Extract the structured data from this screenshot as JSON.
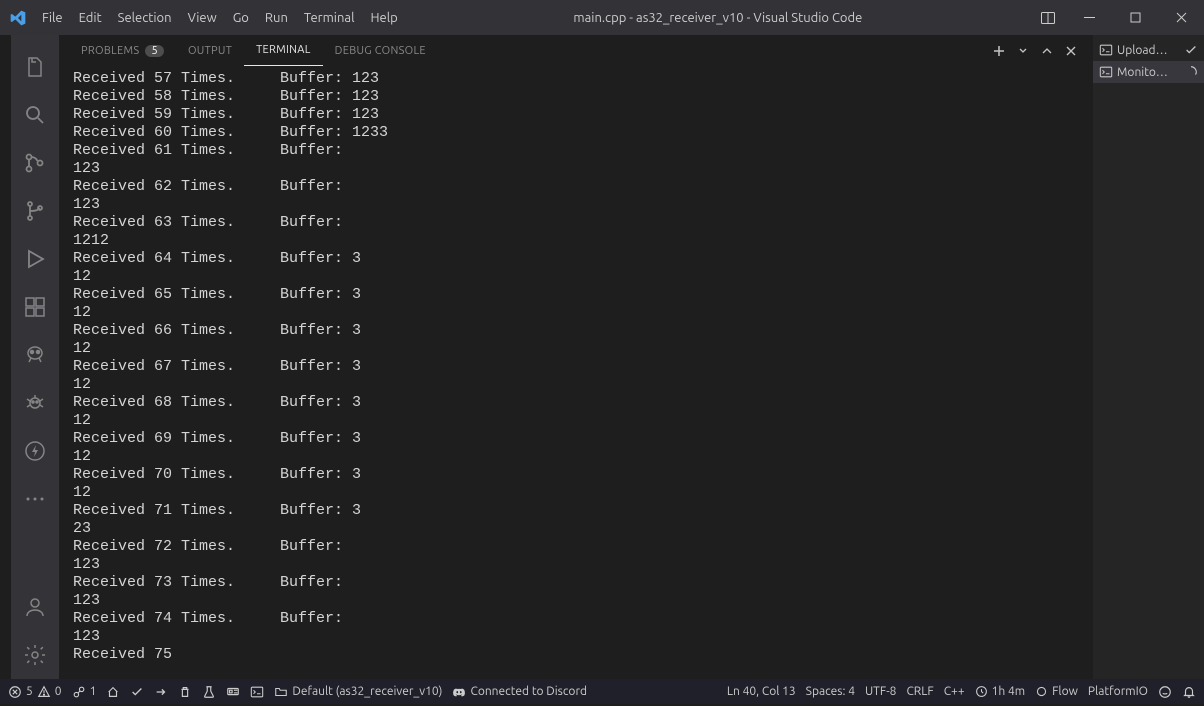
{
  "titlebar": {
    "menu": [
      "File",
      "Edit",
      "Selection",
      "View",
      "Go",
      "Run",
      "Terminal",
      "Help"
    ],
    "title": "main.cpp - as32_receiver_v10 - Visual Studio Code"
  },
  "panel": {
    "tabs": {
      "problems": "PROBLEMS",
      "problems_count": "5",
      "output": "OUTPUT",
      "terminal": "TERMINAL",
      "debug_console": "DEBUG CONSOLE"
    }
  },
  "terminal_output": "Received 57 Times.     Buffer: 123\nReceived 58 Times.     Buffer: 123\nReceived 59 Times.     Buffer: 123\nReceived 60 Times.     Buffer: 1233\nReceived 61 Times.     Buffer: \n123\nReceived 62 Times.     Buffer: \n123\nReceived 63 Times.     Buffer: \n1212\nReceived 64 Times.     Buffer: 3\n12\nReceived 65 Times.     Buffer: 3\n12\nReceived 66 Times.     Buffer: 3\n12\nReceived 67 Times.     Buffer: 3\n12\nReceived 68 Times.     Buffer: 3\n12\nReceived 69 Times.     Buffer: 3\n12\nReceived 70 Times.     Buffer: 3\n12\nReceived 71 Times.     Buffer: 3\n23\nReceived 72 Times.     Buffer: \n123\nReceived 73 Times.     Buffer: \n123\nReceived 74 Times.     Buffer: \n123\nReceived 75",
  "tasks": [
    {
      "label": "Upload…",
      "active": false,
      "status": "done"
    },
    {
      "label": "Monito…",
      "active": true,
      "status": "loading"
    }
  ],
  "statusbar": {
    "errors": "5",
    "warnings": "0",
    "ports": "1",
    "env": "Default (as32_receiver_v10)",
    "discord": "Connected to Discord",
    "cursor": "Ln 40, Col 13",
    "spaces": "Spaces: 4",
    "encoding": "UTF-8",
    "eol": "CRLF",
    "lang": "C++",
    "time": "1h 4m",
    "flow": "Flow",
    "platform": "PlatformIO"
  }
}
